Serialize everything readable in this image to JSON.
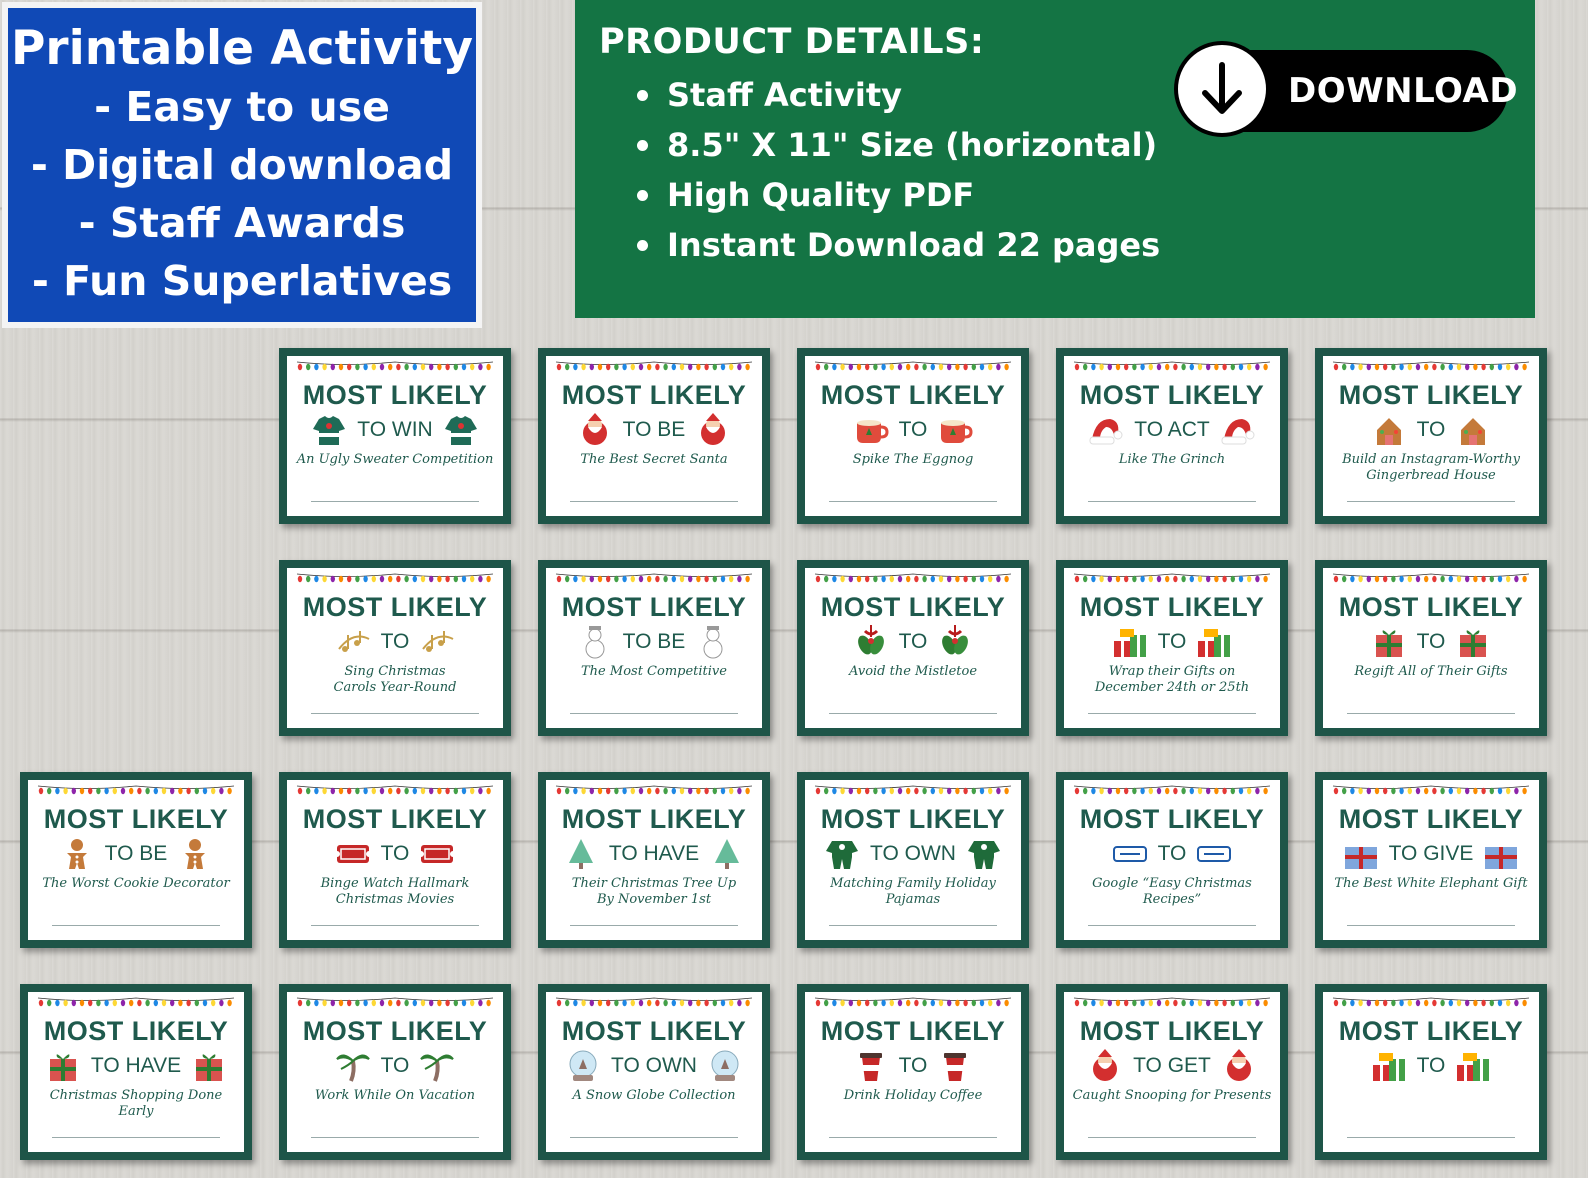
{
  "promo": {
    "title": "Printable Activity",
    "items": [
      "- Easy to use",
      "- Digital download",
      "- Staff Awards",
      "- Fun Superlatives"
    ]
  },
  "details": {
    "title": "PRODUCT DETAILS:",
    "items": [
      "Staff Activity",
      "8.5\" X 11\" Size (horizontal)",
      "High Quality PDF",
      "Instant Download 22 pages"
    ],
    "download_label": "DOWNLOAD"
  },
  "colors": {
    "promo_blue": "#1049b6",
    "details_green": "#147444",
    "card_border": "#1e5548",
    "card_text": "#1f5a4d"
  },
  "cards": [
    {
      "title": "MOST LIKELY",
      "sub": "TO WIN",
      "desc": "An Ugly Sweater Competition",
      "icon": "sweater-icon"
    },
    {
      "title": "MOST LIKELY",
      "sub": "TO BE",
      "desc": "The Best Secret Santa",
      "icon": "santa-icon"
    },
    {
      "title": "MOST LIKELY",
      "sub": "TO",
      "desc": "Spike The Eggnog",
      "icon": "mug-icon"
    },
    {
      "title": "MOST LIKELY",
      "sub": "TO ACT",
      "desc": "Like The Grinch",
      "icon": "santa-hat-icon"
    },
    {
      "title": "MOST LIKELY",
      "sub": "TO",
      "desc": "Build an Instagram-Worthy\nGingerbread House",
      "icon": "gingerbread-house-icon"
    },
    {
      "title": "MOST LIKELY",
      "sub": "TO",
      "desc": "Sing Christmas\nCarols Year-Round",
      "icon": "music-notes-icon"
    },
    {
      "title": "MOST LIKELY",
      "sub": "TO BE",
      "desc": "The Most Competitive",
      "icon": "snowman-icon"
    },
    {
      "title": "MOST LIKELY",
      "sub": "TO",
      "desc": "Avoid the Mistletoe",
      "icon": "mistletoe-icon"
    },
    {
      "title": "MOST LIKELY",
      "sub": "TO",
      "desc": "Wrap their Gifts on\nDecember 24th or 25th",
      "icon": "gifts-icon"
    },
    {
      "title": "MOST LIKELY",
      "sub": "TO",
      "desc": "Regift All of Their Gifts",
      "icon": "gift-icon"
    },
    {
      "title": "MOST LIKELY",
      "sub": "TO BE",
      "desc": "The Worst Cookie Decorator",
      "icon": "cookie-icon"
    },
    {
      "title": "MOST LIKELY",
      "sub": "TO",
      "desc": "Binge Watch Hallmark\nChristmas Movies",
      "icon": "movie-ticket-icon"
    },
    {
      "title": "MOST LIKELY",
      "sub": "TO HAVE",
      "desc": "Their Christmas Tree Up\nBy November 1st",
      "icon": "tree-icon"
    },
    {
      "title": "MOST LIKELY",
      "sub": "TO OWN",
      "desc": "Matching Family Holiday Pajamas",
      "icon": "pajamas-icon"
    },
    {
      "title": "MOST LIKELY",
      "sub": "TO",
      "desc": "Google “Easy Christmas Recipes”",
      "icon": "recipe-icon"
    },
    {
      "title": "MOST LIKELY",
      "sub": "TO GIVE",
      "desc": "The Best White Elephant Gift",
      "icon": "present-icon"
    },
    {
      "title": "MOST LIKELY",
      "sub": "TO HAVE",
      "desc": "Christmas Shopping Done Early",
      "icon": "gift-icon"
    },
    {
      "title": "MOST LIKELY",
      "sub": "TO",
      "desc": "Work While On Vacation",
      "icon": "palm-tree-icon"
    },
    {
      "title": "MOST LIKELY",
      "sub": "TO OWN",
      "desc": "A Snow Globe Collection",
      "icon": "snow-globe-icon"
    },
    {
      "title": "MOST LIKELY",
      "sub": "TO",
      "desc": "Drink Holiday Coffee",
      "icon": "coffee-cup-icon"
    },
    {
      "title": "MOST LIKELY",
      "sub": "TO GET",
      "desc": "Caught Snooping for Presents",
      "icon": "santa-icon"
    },
    {
      "title": "MOST LIKELY",
      "sub": "TO",
      "desc": "",
      "icon": "gifts-icon"
    }
  ]
}
